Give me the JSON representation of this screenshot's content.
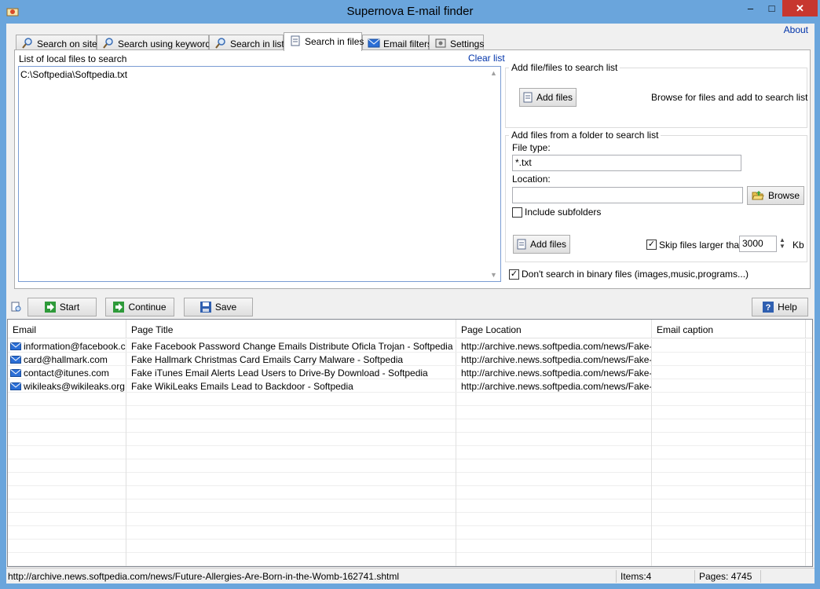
{
  "window": {
    "title": "Supernova E-mail finder",
    "minimize": "–",
    "maximize": "□",
    "close": "✕",
    "about": "About"
  },
  "tabs": [
    {
      "label": "Search on site",
      "icon": "magnifier-icon"
    },
    {
      "label": "Search using keywords",
      "icon": "magnifier-icon"
    },
    {
      "label": "Search in list",
      "icon": "magnifier-icon"
    },
    {
      "label": "Search in files",
      "icon": "document-icon"
    },
    {
      "label": "Email filters",
      "icon": "envelope-icon"
    },
    {
      "label": "Settings",
      "icon": "settings-icon"
    }
  ],
  "files": {
    "list_label": "List of local files to search",
    "clear_label": "Clear list",
    "items": [
      "C:\\Softpedia\\Softpedia.txt"
    ]
  },
  "add_files_group": {
    "label": "Add file/files to search list",
    "button": "Add files",
    "hint": "Browse for files and add to search list"
  },
  "folder_group": {
    "label": "Add files from a folder to search list",
    "file_type_label": "File type:",
    "file_type_value": "*.txt",
    "location_label": "Location:",
    "location_value": "",
    "browse_button": "Browse",
    "include_subfolders_label": "Include subfolders",
    "include_subfolders": false,
    "add_button": "Add files",
    "skip_label": "Skip files larger than",
    "skip_checked": true,
    "skip_value": "3000",
    "skip_unit": "Kb"
  },
  "binary_option": {
    "label": "Don't search in binary files (images,music,programs...)",
    "checked": true
  },
  "toolbar": {
    "start": "Start",
    "continue": "Continue",
    "save": "Save",
    "help": "Help"
  },
  "results": {
    "columns": [
      "Email",
      "Page Title",
      "Page Location",
      "Email caption"
    ],
    "rows": [
      [
        "information@facebook.c...",
        "Fake Facebook Password Change Emails Distribute Oficla Trojan - Softpedia",
        "http://archive.news.softpedia.com/news/Fake-...",
        ""
      ],
      [
        "card@hallmark.com",
        "Fake Hallmark Christmas Card Emails Carry Malware - Softpedia",
        "http://archive.news.softpedia.com/news/Fake-...",
        ""
      ],
      [
        "contact@itunes.com",
        "Fake iTunes Email Alerts Lead Users to Drive-By Download - Softpedia",
        "http://archive.news.softpedia.com/news/Fake-i...",
        ""
      ],
      [
        "wikileaks@wikileaks.org",
        "Fake WikiLeaks Emails Lead to Backdoor - Softpedia",
        "http://archive.news.softpedia.com/news/Fake-...",
        ""
      ]
    ]
  },
  "status": {
    "url": "http://archive.news.softpedia.com/news/Future-Allergies-Are-Born-in-the-Womb-162741.shtml",
    "items": "Items:4",
    "pages": "Pages: 4745"
  },
  "colors": {
    "title_bar": "#6aa5dc",
    "close_button": "#c7372f",
    "link": "#0033aa",
    "focus_border": "#7a9cd3"
  }
}
